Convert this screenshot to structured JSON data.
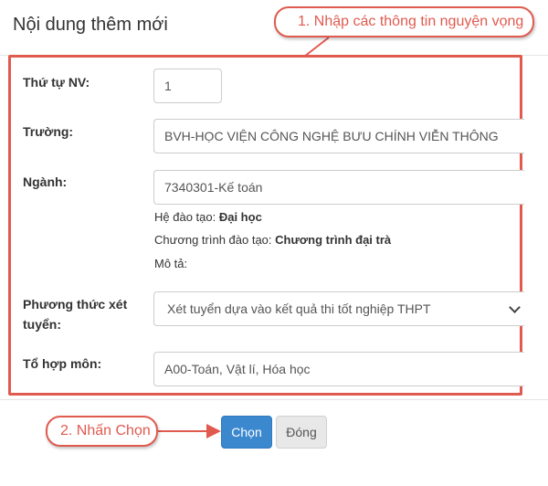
{
  "modal": {
    "title": "Nội dung thêm mới"
  },
  "callouts": {
    "step1": "1. Nhập các thông tin nguyện vọng",
    "step2": "2. Nhấn Chọn"
  },
  "form": {
    "order": {
      "label": "Thứ tự NV:",
      "value": "1"
    },
    "school": {
      "label": "Trường:",
      "value": "BVH-HỌC VIỆN CÔNG NGHỆ BƯU CHÍNH VIỄN THÔNG"
    },
    "major": {
      "label": "Ngành:",
      "value": "7340301-Kế toán",
      "training_level_label": "Hệ đào tạo:",
      "training_level_value": "Đại học",
      "program_label": "Chương trình đào tạo:",
      "program_value": "Chương trình đại trà",
      "description_label": "Mô tả:"
    },
    "method": {
      "label": "Phương thức xét tuyển:",
      "value": "Xét tuyển dựa vào kết quả thi tốt nghiệp THPT"
    },
    "subjects": {
      "label": "Tổ hợp môn:",
      "value": "A00-Toán, Vật lí, Hóa học"
    }
  },
  "buttons": {
    "choose": "Chọn",
    "close": "Đóng"
  },
  "colors": {
    "annotation": "#e05a4f",
    "primary": "#3c88cf"
  }
}
